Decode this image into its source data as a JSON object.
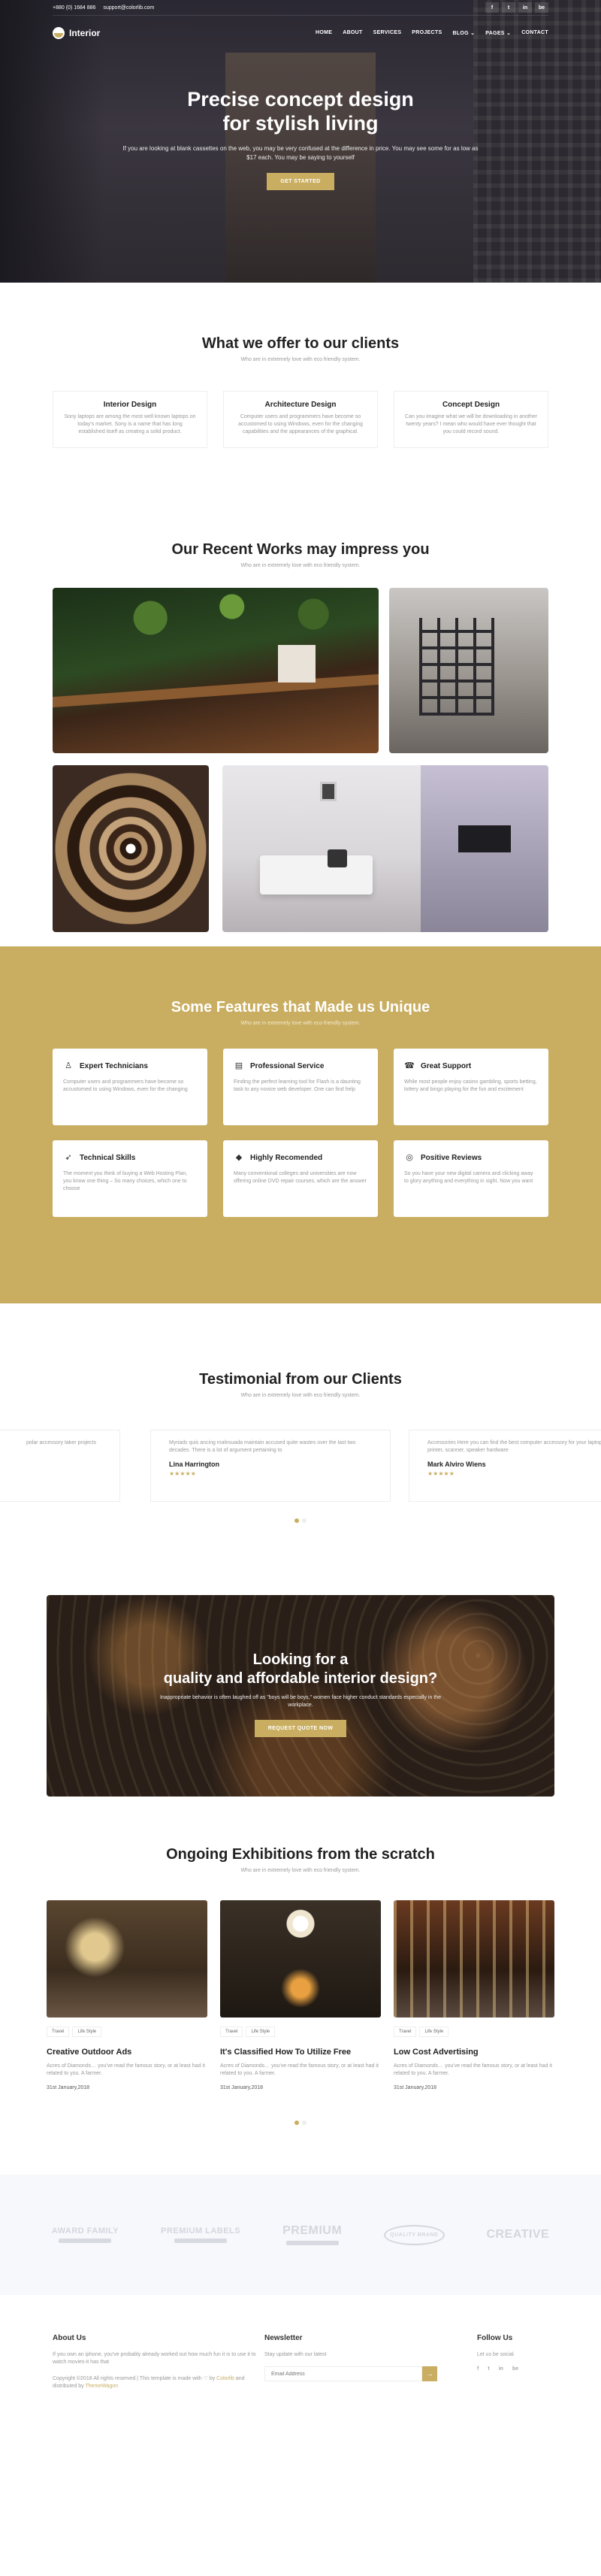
{
  "topbar": {
    "phone": "+880 (0) 1684 886",
    "email": "support@colorlib.com",
    "social": [
      "f",
      "t",
      "in",
      "be"
    ]
  },
  "nav": {
    "logo": "Interior",
    "items": [
      "HOME",
      "ABOUT",
      "SERVICES",
      "PROJECTS",
      "BLOG ⌄",
      "PAGES ⌄",
      "CONTACT"
    ]
  },
  "hero": {
    "title_line1": "Precise concept design",
    "title_line2": "for stylish living",
    "text": "If you are looking at blank cassettes on the web, you may be very confused at the difference in price. You may see some for as low as $17 each. You may be saying to yourself",
    "cta": "GET STARTED"
  },
  "offers": {
    "title": "What we offer to our clients",
    "subtitle": "Who are in extremely love with eco friendly system.",
    "items": [
      {
        "title": "Interior Design",
        "text": "Sony laptops are among the most well known laptops on today's market. Sony is a name that has long established itself as creating a solid product."
      },
      {
        "title": "Architecture Design",
        "text": "Computer users and programmers have become so accustomed to using Windows, even for the changing capabilities and the appearances of the graphical."
      },
      {
        "title": "Concept Design",
        "text": "Can you imagine what we will be downloading in another twenty years? I mean who would have ever thought that you could record sound."
      }
    ]
  },
  "works": {
    "title": "Our Recent Works may impress you",
    "subtitle": "Who are in extremely love with eco friendly system."
  },
  "features": {
    "title": "Some Features that Made us Unique",
    "subtitle": "Who are in extremely love with eco friendly system.",
    "items": [
      {
        "icon": "user-icon",
        "glyph": "♙",
        "title": "Expert Technicians",
        "text": "Computer users and programmers have become so accustomed to using Windows, even for the changing"
      },
      {
        "icon": "license-icon",
        "glyph": "▤",
        "title": "Professional Service",
        "text": "Finding the perfect learning tool for Flash is a daunting task to any novice web developer. One can find help"
      },
      {
        "icon": "phone-icon",
        "glyph": "☎",
        "title": "Great Support",
        "text": "While most people enjoy casino gambling, sports betting, lottery and bingo playing for the fun and excitement"
      },
      {
        "icon": "rocket-icon",
        "glyph": "➶",
        "title": "Technical Skills",
        "text": "The moment you think of buying a Web Hosting Plan, you know one thing – So many choices, which one to choose"
      },
      {
        "icon": "diamond-icon",
        "glyph": "◆",
        "title": "Highly Recomended",
        "text": "Many conventional colleges and universities are now offering online DVD repair courses, which are the answer"
      },
      {
        "icon": "bubble-icon",
        "glyph": "◎",
        "title": "Positive Reviews",
        "text": "So you have your new digital camera and clicking away to glory anything and everything in sight. Now you want"
      }
    ]
  },
  "testimonials": {
    "title": "Testimonial from our Clients",
    "subtitle": "Who are in extremely love with eco friendly system.",
    "items": [
      {
        "text": "polar accessory taker projects",
        "name": "",
        "stars": ""
      },
      {
        "text": "Myriads quis ancing malesuada maintain accused quite wastes over the last two decades. There is a lot of argument pertaining to",
        "name": "Lina Harrington",
        "stars": "★★★★★"
      },
      {
        "text": "Accessories Here you can find the best computer accessory for your laptop, monitor, printer, scanner, speaker hardware",
        "name": "Mark Alviro Wiens",
        "stars": "★★★★★"
      }
    ]
  },
  "cta": {
    "title_line1": "Looking for a",
    "title_line2": "quality and affordable interior design?",
    "text": "Inappropriate behavior is often laughed off as \"boys will be boys,\" women face higher conduct standards especially in the workplace.",
    "button": "REQUEST QUOTE NOW"
  },
  "exhibitions": {
    "title": "Ongoing Exhibitions from the scratch",
    "subtitle": "Who are in extremely love with eco friendly system.",
    "items": [
      {
        "tags": [
          "Travel",
          "Life Style"
        ],
        "title": "Creative Outdoor Ads",
        "text": "Acres of Diamonds… you've read the famous story, or at least had it related to you. A farmer.",
        "date": "31st January,2018"
      },
      {
        "tags": [
          "Travel",
          "Life Style"
        ],
        "title": "It's Classified How To Utilize Free",
        "text": "Acres of Diamonds… you've read the famous story, or at least had it related to you. A farmer.",
        "date": "31st January,2018"
      },
      {
        "tags": [
          "Travel",
          "Life Style"
        ],
        "title": "Low Cost Advertising",
        "text": "Acres of Diamonds… you've read the famous story, or at least had it related to you. A farmer.",
        "date": "31st January,2018"
      }
    ]
  },
  "brands": [
    "AWARD FAMILY",
    "PREMIUM LABELS",
    "PREMIUM",
    "QUALITY BRAND",
    "CREATIVE"
  ],
  "footer": {
    "about_title": "About Us",
    "about_text": "If you own an iphone, you've probably already worked out how much fun it is to use it to watch movies-it has that",
    "copyright_pre": "Copyright ©2018 All rights reserved | This template is made with ♡ by",
    "copyright_by": "Colorlib",
    "copyright_mid": "and distributed by",
    "copyright_dist": "ThemeWagon",
    "newsletter_title": "Newsletter",
    "newsletter_text": "Stay update with our latest",
    "newsletter_placeholder": "Email Address",
    "follow_title": "Follow Us",
    "follow_text": "Let us be social",
    "follow_icons": [
      "f",
      "t",
      "in",
      "be"
    ]
  }
}
